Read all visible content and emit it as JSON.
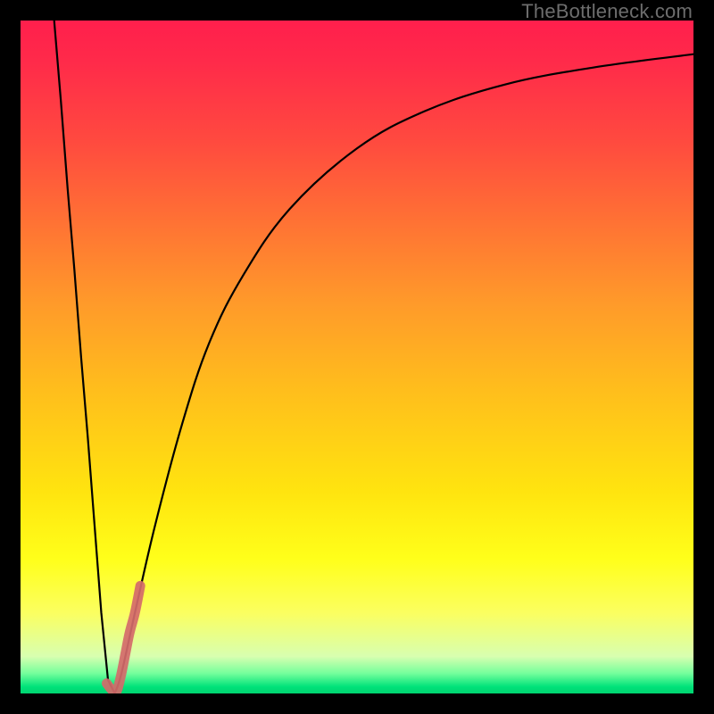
{
  "watermark": "TheBottleneck.com",
  "colors": {
    "line_black": "#000000",
    "highlight_pink": "#d46a6a",
    "frame_black": "#000000"
  },
  "chart_data": {
    "type": "line",
    "title": "",
    "xlabel": "",
    "ylabel": "",
    "xlim": [
      0,
      100
    ],
    "ylim": [
      0,
      100
    ],
    "series": [
      {
        "name": "bottleneck-curve",
        "x": [
          5,
          6,
          7,
          8,
          9,
          10,
          11,
          12,
          13,
          14,
          15,
          17,
          20,
          24,
          28,
          33,
          40,
          50,
          60,
          72,
          85,
          100
        ],
        "y": [
          100,
          88,
          75,
          63,
          50,
          38,
          25,
          12,
          2,
          0,
          3,
          12,
          25,
          40,
          52,
          62,
          72,
          81,
          86.5,
          90.5,
          93,
          95
        ]
      },
      {
        "name": "highlight-segment",
        "x": [
          12.8,
          13.5,
          14.0,
          14.4,
          15.0,
          15.6,
          16.2,
          17.0,
          17.8
        ],
        "y": [
          1.5,
          0.6,
          0.3,
          0.6,
          3.0,
          6.0,
          9.0,
          12.0,
          16.0
        ]
      }
    ]
  }
}
